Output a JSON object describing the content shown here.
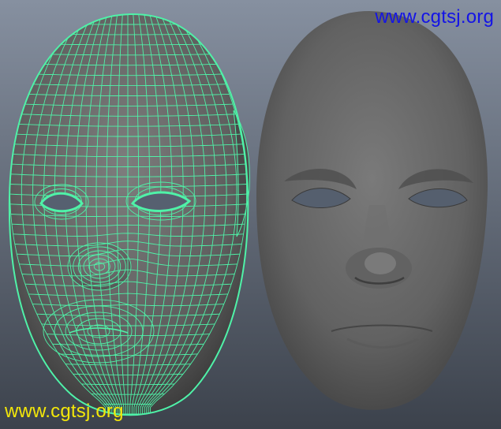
{
  "viewport": {
    "background_top": "#8690a0",
    "background_bottom": "#3c424c",
    "wire_color": "#4ff2a8",
    "shaded_color": "#6b6b6b"
  },
  "models": {
    "left": {
      "display_mode": "wireframe-on-shaded"
    },
    "right": {
      "display_mode": "smooth-shaded"
    }
  },
  "watermarks": {
    "top": {
      "text": "www.cgtsj.org",
      "color": "#1414e6"
    },
    "bottom": {
      "text": "www.cgtsj.org",
      "color": "#f2e60a"
    }
  }
}
